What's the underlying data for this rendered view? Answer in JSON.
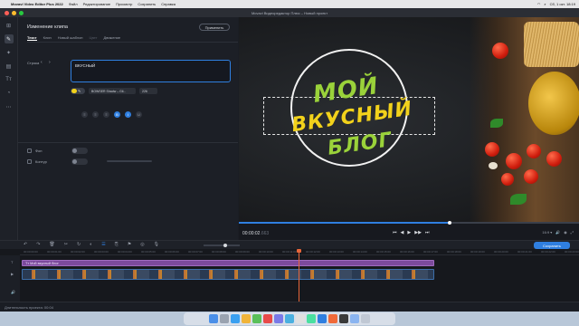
{
  "menubar": {
    "app": "Movavi Video Editor Plus 2022",
    "items": [
      "Файл",
      "Редактирование",
      "Просмотр",
      "Сохранить",
      "Справка"
    ],
    "clock": "Сб, 1 окт. 18:19"
  },
  "window": {
    "title": "Movavi Видеоредактор Плюс – Новый проект"
  },
  "panel": {
    "title": "Изменение клипа",
    "apply_label": "Применить",
    "tabs": [
      {
        "label": "Текст",
        "state": "active"
      },
      {
        "label": "Клип",
        "state": "normal"
      },
      {
        "label": "Новый шаблон",
        "state": "normal"
      },
      {
        "label": "Цвет",
        "state": "disabled"
      },
      {
        "label": "Движение",
        "state": "normal"
      }
    ],
    "row_label": "Строка",
    "row_nav": "‹ ›",
    "text_value": "ВКУСНЫЙ",
    "color_pill_edit": "✎",
    "font_name": "BOWSER Shadw – Gil...",
    "font_size": "226",
    "style_buttons": [
      "≡",
      "≡",
      "≡",
      "B",
      "I",
      "U"
    ],
    "bg_label": "Фон",
    "outline_label": "Контур"
  },
  "preview": {
    "logo_lines": [
      "МОЙ",
      "ВКУСНЫЙ",
      "БЛОГ"
    ],
    "timecode_main": "00:00:02",
    "timecode_frac": ".663",
    "progress": 0.62,
    "aspect": "16:9 ▾",
    "controls": [
      "⏮",
      "◀",
      "▶",
      "▶▶",
      "⏭"
    ]
  },
  "timeline_toolbar": {
    "tools": [
      "↶",
      "↷",
      "🗑",
      "✂",
      "↻",
      "◐",
      "☰",
      "⎘",
      "⚑",
      "◎",
      "🎙"
    ],
    "save_label": "Сохранить"
  },
  "timeline": {
    "ticks": [
      "00:00:00:00",
      "00:00:01:00",
      "00:00:02:00",
      "00:00:03:00",
      "00:00:04:00",
      "00:00:05:00",
      "00:00:06:00",
      "00:00:07:00",
      "00:00:08:00",
      "00:00:09:00",
      "00:00:10:00",
      "00:00:11:00",
      "00:00:12:00",
      "00:00:13:00",
      "00:00:14:00",
      "00:00:15:00",
      "00:00:16:00",
      "00:00:17:00",
      "00:00:18:00",
      "00:00:19:00",
      "00:00:20:00",
      "00:00:21:00",
      "00:00:22:00",
      "00:00:23:00"
    ],
    "title_clip": "Tт Мой вкусный блог",
    "track_icons": [
      "T",
      "▶",
      "🔊"
    ]
  },
  "status": {
    "text": "Длительность проекта: 00:04"
  },
  "colors": {
    "accent": "#2f7fe0",
    "logo_green": "#9ad23a",
    "logo_yellow": "#f2d21b",
    "title_clip": "#7c4a9c",
    "playhead": "#e8663a"
  }
}
